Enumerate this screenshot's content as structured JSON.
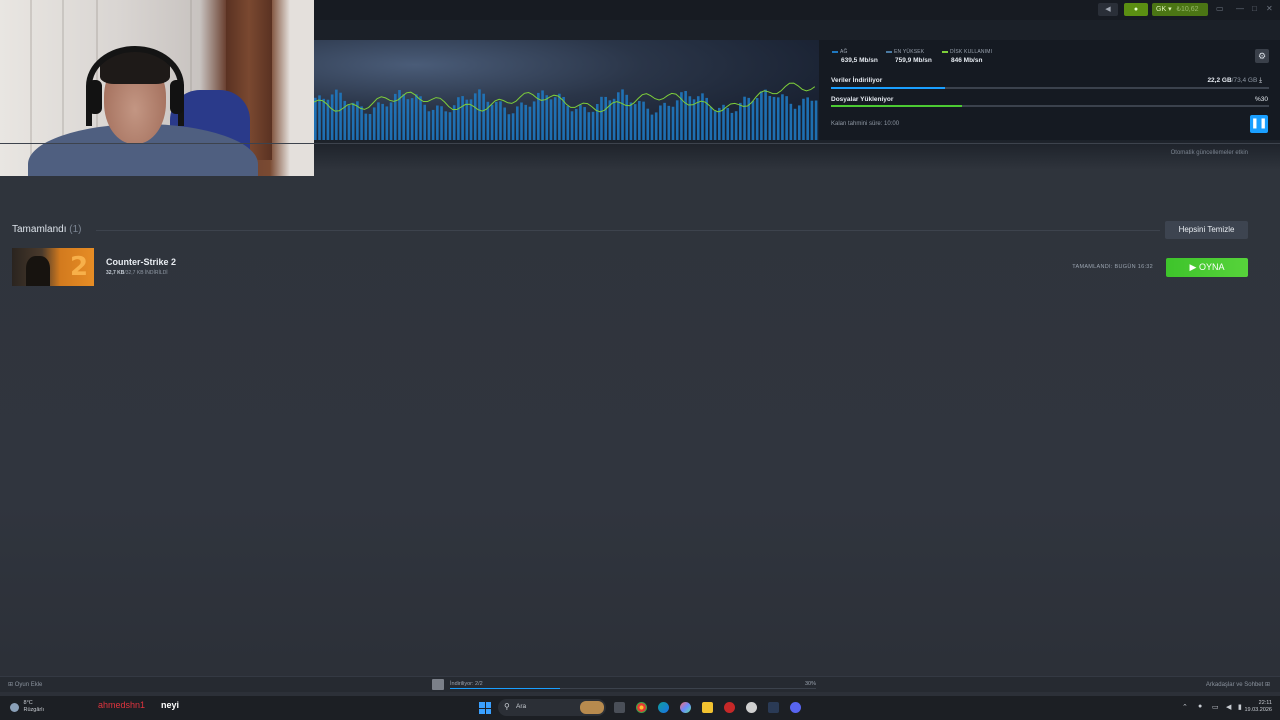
{
  "topbar": {
    "user_label": "GK",
    "balance": "₺10,62"
  },
  "stats": {
    "network_label": "AĞ",
    "network_value": "639,5 Mb/sn",
    "peak_label": "EN YÜKSEK",
    "peak_value": "759,9 Mb/sn",
    "disk_label": "DİSK KULLANIMI",
    "disk_value": "846 Mb/sn"
  },
  "download": {
    "downloading_label": "Veriler İndiriliyor",
    "downloaded": "22,2 GB",
    "total": "/73,4 GB",
    "downloading_progress": 0.26,
    "installing_label": "Dosyalar Yükleniyor",
    "installing_percent": "%30",
    "installing_progress": 0.3,
    "eta": "Kalan tahmini süre: 10:00",
    "auto_updates": "Otomatik güncellemeler etkin"
  },
  "completed": {
    "title": "Tamamlandı",
    "count": "(1)",
    "clear_all": "Hepsini Temizle",
    "game": {
      "name": "Counter-Strike 2",
      "size_done": "32,7 KB",
      "size_rest": "/32,7 KB İNDİRİLDİ",
      "completed_at": "TAMAMLANDI: BUGÜN 16:32",
      "play": "OYNA"
    }
  },
  "footer": {
    "add_game": "Oyun Ekle",
    "downloading": "İndiriliyor: 2/2",
    "percent": "30%",
    "progress": 0.3,
    "friends": "Arkadaşlar ve Sohbet"
  },
  "taskbar": {
    "weather_temp": "8°C",
    "weather_desc": "Rüzgârlı",
    "chat_user": "ahmedshn1",
    "chat_message": "neyi",
    "search_placeholder": "Ara",
    "time": "22:11",
    "date": "19.03.2026"
  },
  "colors": {
    "accent_blue": "#1a9fff",
    "play_green": "#4ccb33",
    "chart_bars": "#1f78c0",
    "chart_line": "#7ecf3a"
  }
}
